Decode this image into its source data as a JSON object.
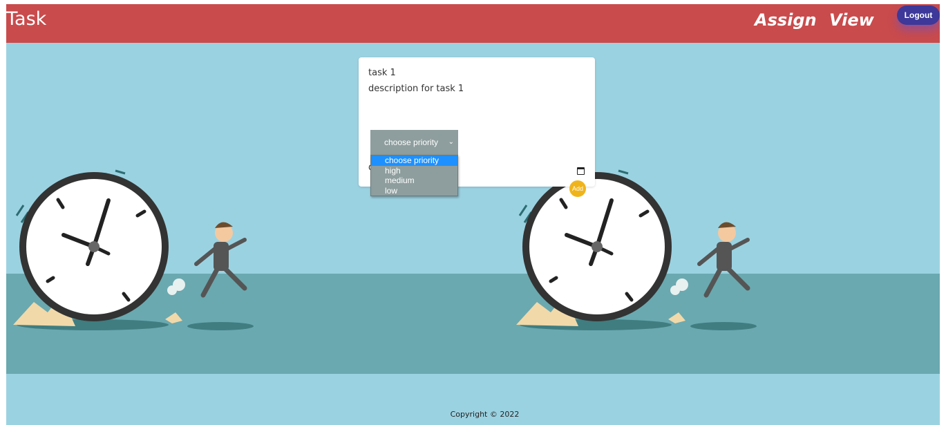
{
  "header": {
    "brand": "Task",
    "nav": [
      "Assign",
      "View"
    ],
    "logout_label": "Logout"
  },
  "form": {
    "title_value": "task 1",
    "description_value": "description for task 1",
    "date_stub": "d",
    "priority": {
      "selected": "choose priority",
      "options": [
        "choose priority",
        "high",
        "medium",
        "low"
      ],
      "highlighted_index": 0
    },
    "add_label": "Add"
  },
  "footer": {
    "copyright": "Copyright © 2022"
  },
  "colors": {
    "header_bg": "#c94b4c",
    "page_bg": "#9bd2e1",
    "ground": "#6aa9b0",
    "logout_bg": "#3d3899",
    "add_button": "#f0b41b",
    "select_bg": "#8e9d9d",
    "option_highlight": "#1e90ff"
  },
  "icons": [
    "chevron-down-icon",
    "calendar-icon",
    "clock-illustration",
    "running-man-illustration"
  ]
}
